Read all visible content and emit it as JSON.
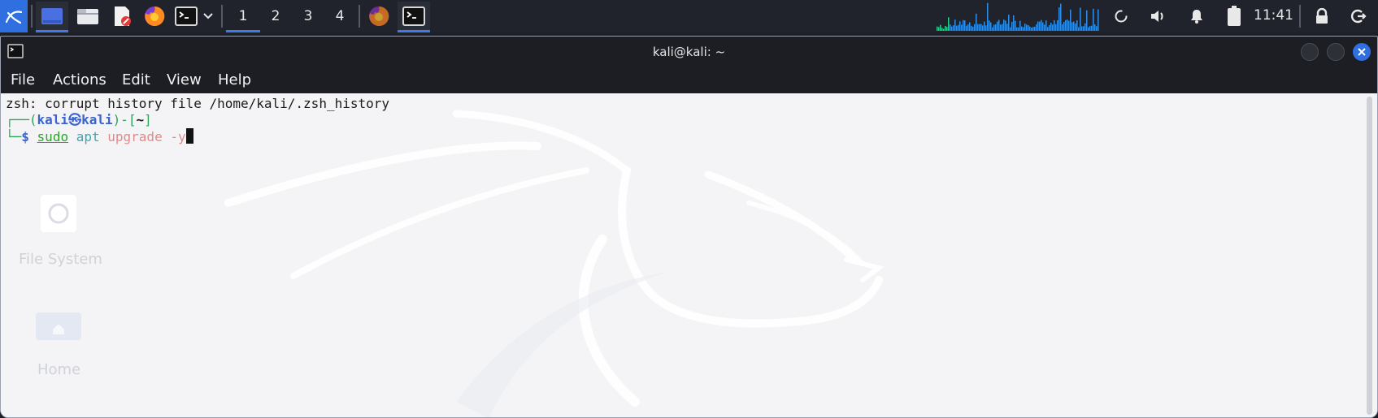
{
  "panel": {
    "workspaces": [
      "1",
      "2",
      "3",
      "4"
    ],
    "active_workspace": "1",
    "clock": "11:41",
    "icons": [
      "kali-menu-icon",
      "show-desktop-icon",
      "file-manager-icon",
      "text-editor-icon",
      "firefox-icon",
      "terminal-icon",
      "chevron-down-icon",
      "firefox-task-icon",
      "terminal-task-icon",
      "cpu-graph-icon",
      "update-icon",
      "volume-icon",
      "notifications-icon",
      "battery-icon",
      "lock-icon",
      "logout-icon"
    ],
    "accent_color": "#3d7ce8"
  },
  "window": {
    "title": "kali@kali: ~",
    "menu": [
      "File",
      "Actions",
      "Edit",
      "View",
      "Help"
    ]
  },
  "terminal": {
    "line1": "zsh: corrupt history file /home/kali/.zsh_history",
    "prompt_open": "┌──(",
    "user": "kali",
    "at_symbol": "㉿",
    "host": "kali",
    "prompt_dir_open": ")-[",
    "cwd": "~",
    "prompt_dir_close": "]",
    "prompt_second": "└─",
    "dollar": "$",
    "cmd_sudo": "sudo",
    "cmd_apt": "apt",
    "cmd_upgrade": "upgrade",
    "cmd_flag": "-y"
  },
  "desktop": {
    "icons": [
      {
        "label": "File System"
      },
      {
        "label": "Home"
      }
    ]
  }
}
